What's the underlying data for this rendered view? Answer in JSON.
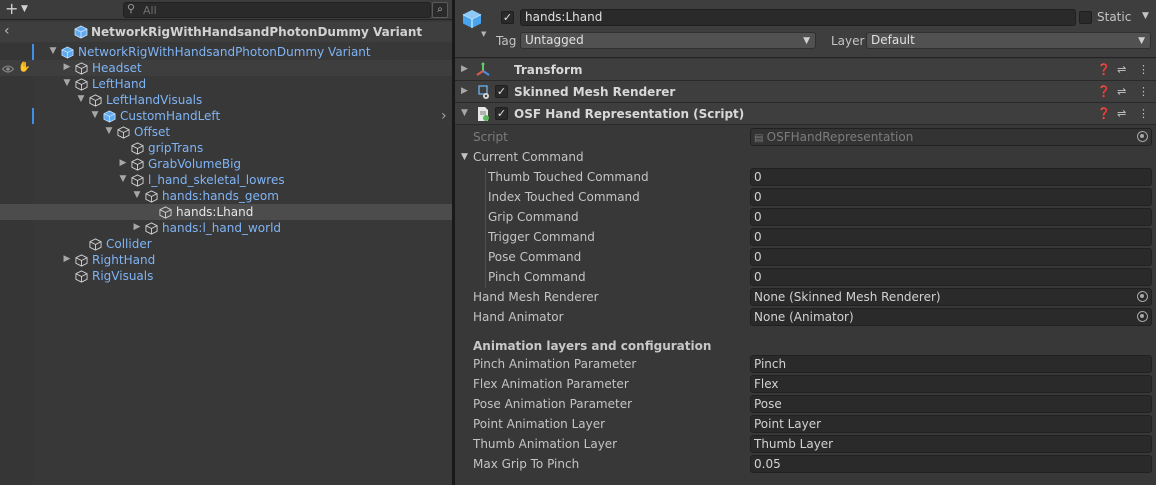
{
  "hierarchy": {
    "search_placeholder": "All",
    "scene_title": "NetworkRigWithHandsandPhotonDummy Variant",
    "rows": [
      {
        "label": "NetworkRigWithHandsandPhotonDummy Variant",
        "depth": 0,
        "arrow": "down",
        "icon": "prefab"
      },
      {
        "label": "Headset",
        "depth": 1,
        "arrow": "right",
        "icon": "cube"
      },
      {
        "label": "LeftHand",
        "depth": 1,
        "arrow": "down",
        "icon": "cube"
      },
      {
        "label": "LeftHandVisuals",
        "depth": 2,
        "arrow": "down",
        "icon": "cube"
      },
      {
        "label": "CustomHandLeft",
        "depth": 3,
        "arrow": "down",
        "icon": "prefab"
      },
      {
        "label": "Offset",
        "depth": 4,
        "arrow": "down",
        "icon": "cube"
      },
      {
        "label": "gripTrans",
        "depth": 5,
        "arrow": "none",
        "icon": "cube"
      },
      {
        "label": "GrabVolumeBig",
        "depth": 5,
        "arrow": "right",
        "icon": "cube"
      },
      {
        "label": "l_hand_skeletal_lowres",
        "depth": 5,
        "arrow": "down",
        "icon": "cube"
      },
      {
        "label": "hands:hands_geom",
        "depth": 6,
        "arrow": "down",
        "icon": "cube"
      },
      {
        "label": "hands:Lhand",
        "depth": 7,
        "arrow": "none",
        "icon": "cube"
      },
      {
        "label": "hands:l_hand_world",
        "depth": 6,
        "arrow": "right",
        "icon": "cube"
      },
      {
        "label": "Collider",
        "depth": 2,
        "arrow": "none",
        "icon": "cube"
      },
      {
        "label": "RightHand",
        "depth": 1,
        "arrow": "right",
        "icon": "cube"
      },
      {
        "label": "RigVisuals",
        "depth": 1,
        "arrow": "none",
        "icon": "cube"
      }
    ]
  },
  "inspector": {
    "object_name": "hands:Lhand",
    "static_label": "Static",
    "tag_label": "Tag",
    "tag_value": "Untagged",
    "layer_label": "Layer",
    "layer_value": "Default",
    "components": {
      "transform": "Transform",
      "skinned": "Skinned Mesh Renderer",
      "script": "OSF Hand Representation (Script)"
    },
    "script_label": "Script",
    "script_value": "OSFHandRepresentation",
    "current_command_label": "Current Command",
    "commands": [
      {
        "label": "Thumb Touched Command",
        "value": "0"
      },
      {
        "label": "Index Touched Command",
        "value": "0"
      },
      {
        "label": "Grip Command",
        "value": "0"
      },
      {
        "label": "Trigger Command",
        "value": "0"
      },
      {
        "label": "Pose Command",
        "value": "0"
      },
      {
        "label": "Pinch Command",
        "value": "0"
      }
    ],
    "hand_mesh_renderer": {
      "label": "Hand Mesh Renderer",
      "value": "None (Skinned Mesh Renderer)"
    },
    "hand_animator": {
      "label": "Hand Animator",
      "value": "None (Animator)"
    },
    "anim_section": "Animation layers and configuration",
    "anim_props": [
      {
        "label": "Pinch Animation Parameter",
        "value": "Pinch"
      },
      {
        "label": "Flex Animation Parameter",
        "value": "Flex"
      },
      {
        "label": "Pose Animation Parameter",
        "value": "Pose"
      },
      {
        "label": "Point Animation Layer",
        "value": "Point Layer"
      },
      {
        "label": "Thumb Animation Layer",
        "value": "Thumb Layer"
      },
      {
        "label": "Max Grip To Pinch",
        "value": "0.05"
      }
    ]
  },
  "colors": {
    "accent": "#3f8fe6",
    "link_text": "#7fb4f5",
    "panel": "#383838"
  }
}
